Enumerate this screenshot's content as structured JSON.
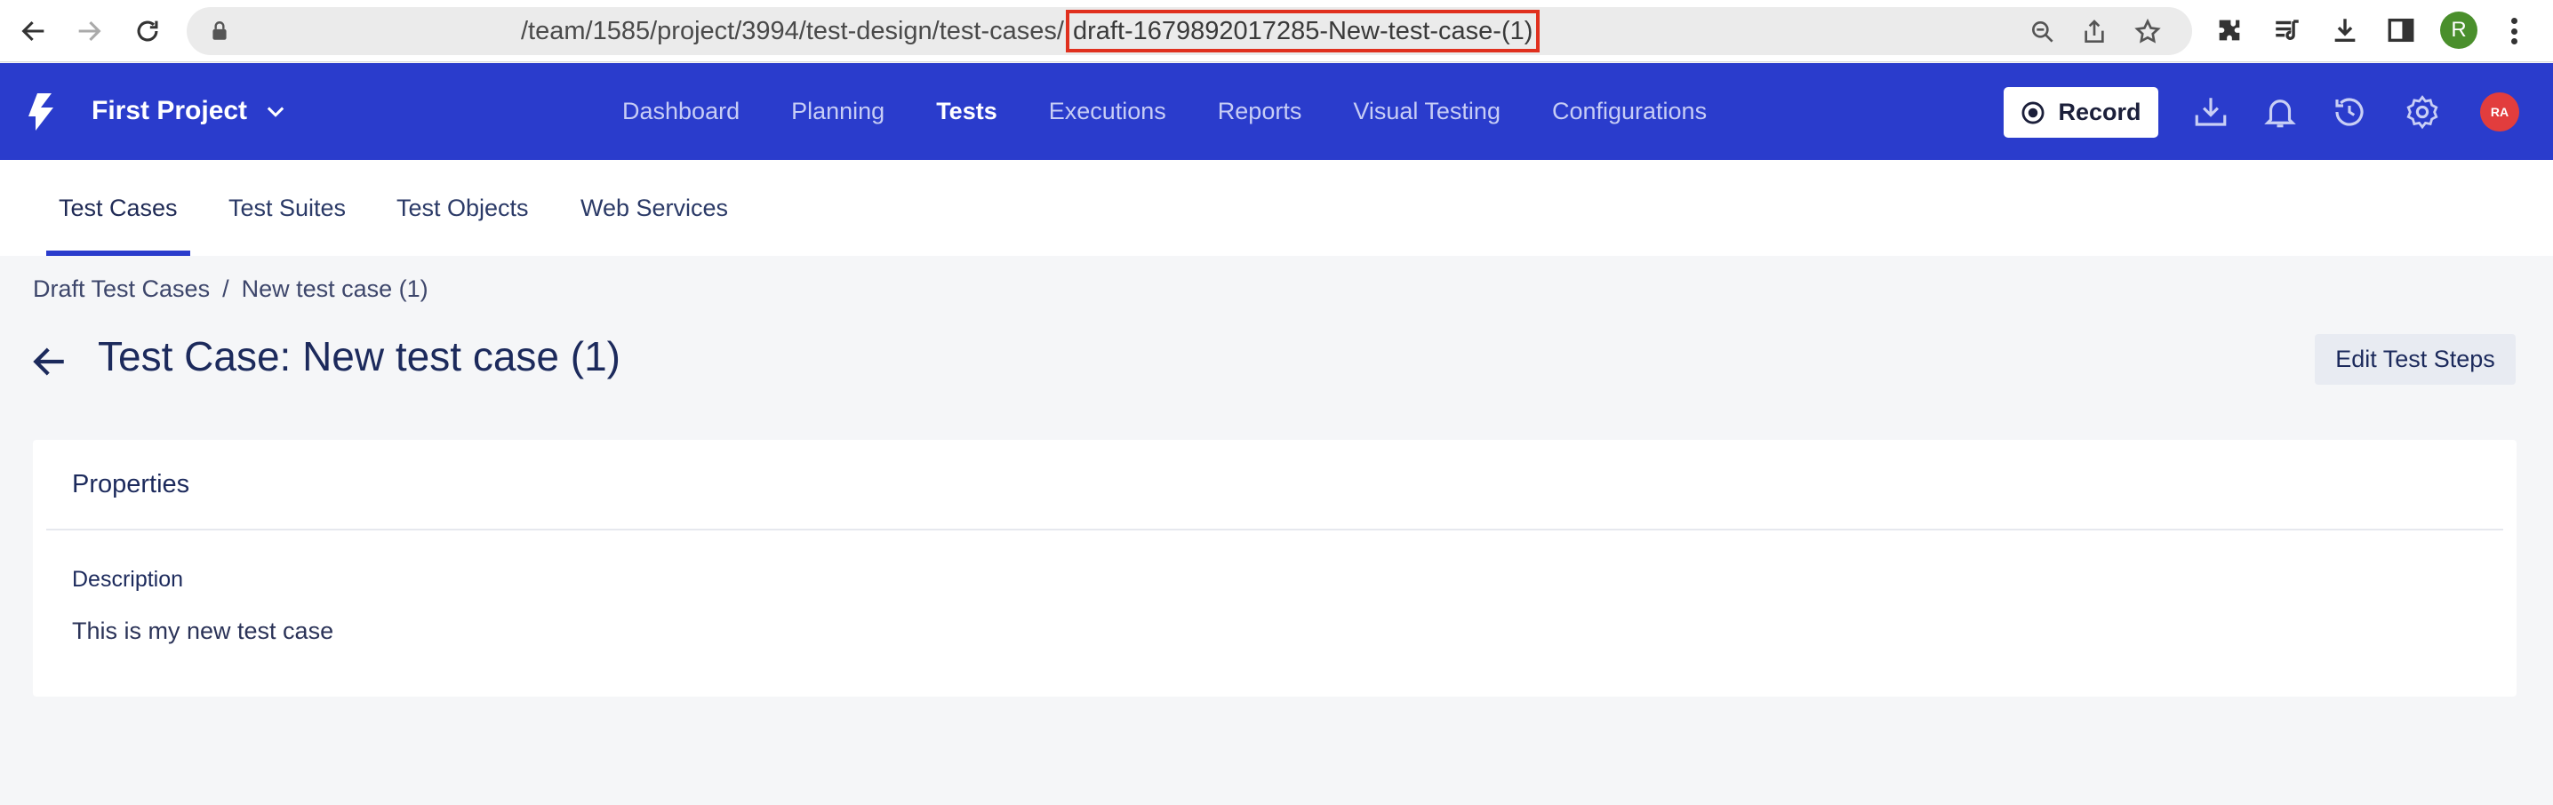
{
  "browser": {
    "url_prefix": "/team/1585/project/3994/test-design/test-cases/",
    "url_highlight": "draft-1679892017285-New-test-case-(1)",
    "profile_initial": "R",
    "icons": [
      "back-icon",
      "forward-icon",
      "reload-icon",
      "lock-icon",
      "zoom-icon",
      "share-icon",
      "bookmark-star-icon",
      "extensions-icon",
      "reading-list-icon",
      "download-icon",
      "side-panel-icon",
      "menu-icon"
    ]
  },
  "header": {
    "project_name": "First Project",
    "nav": [
      "Dashboard",
      "Planning",
      "Tests",
      "Executions",
      "Reports",
      "Visual Testing",
      "Configurations"
    ],
    "active_nav": "Tests",
    "record_label": "Record",
    "avatar_initials": "RA",
    "colors": {
      "bar": "#2a3ccc",
      "avatar": "#e23d3d"
    }
  },
  "subtabs": {
    "items": [
      "Test Cases",
      "Test Suites",
      "Test Objects",
      "Web Services"
    ],
    "active": "Test Cases"
  },
  "breadcrumb": {
    "parent": "Draft Test Cases",
    "separator": "/",
    "current": "New test case (1)"
  },
  "page": {
    "title": "Test Case: New test case (1)",
    "edit_button": "Edit Test Steps"
  },
  "properties": {
    "title": "Properties",
    "description_label": "Description",
    "description_value": "This is my new test case"
  }
}
